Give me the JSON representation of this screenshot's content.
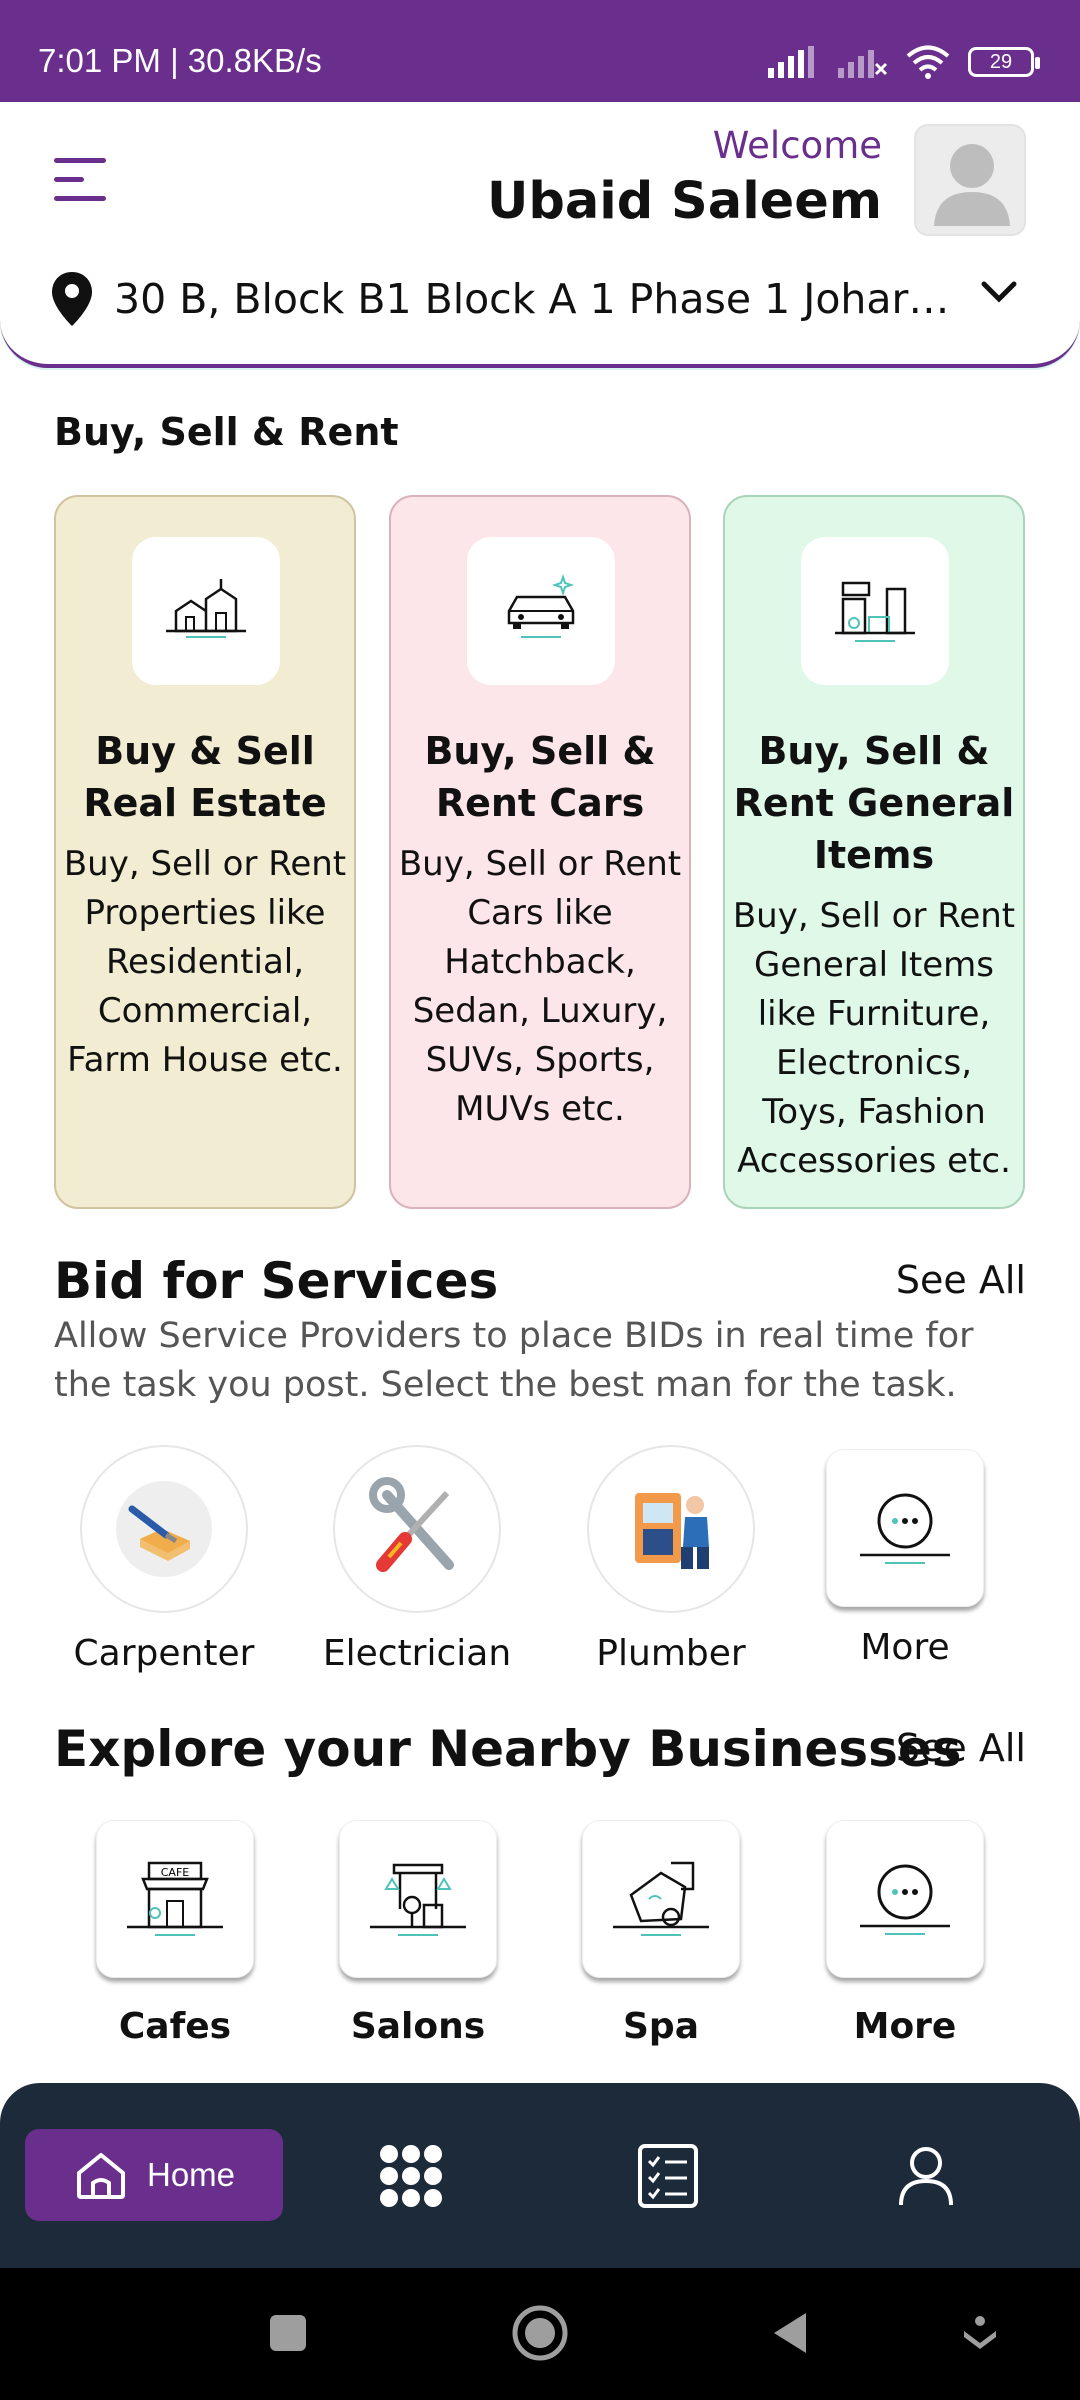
{
  "status_bar": {
    "time": "7:01 PM | 30.8KB/s",
    "battery": "29"
  },
  "header": {
    "welcome": "Welcome",
    "user_name": "Ubaid Saleem",
    "location": "30 B, Block B1 Block A 1 Phase 1 Johar T...",
    "accent_color": "#6a2f8c"
  },
  "buy_sell": {
    "title": "Buy, Sell & Rent",
    "cards": [
      {
        "title": "Buy & Sell Real Estate",
        "description": "Buy, Sell or Rent Properties like Residential, Commercial, Farm House etc.",
        "icon": "real-estate-icon",
        "bg": "#f2ecd2"
      },
      {
        "title": "Buy, Sell & Rent Cars",
        "description": "Buy, Sell or Rent Cars like Hatchback, Sedan, Luxury, SUVs, Sports, MUVs etc.",
        "icon": "car-icon",
        "bg": "#fde6ea"
      },
      {
        "title": "Buy, Sell & Rent General Items",
        "description": "Buy, Sell or Rent General Items like Furniture, Electronics, Toys, Fashion Accessories etc.",
        "icon": "general-items-icon",
        "bg": "#dff8e8"
      }
    ]
  },
  "services": {
    "title": "Bid for Services",
    "see_all": "See All",
    "description": "Allow Service Providers to place BIDs in real time for the task you post. Select the best man for the task.",
    "items": [
      {
        "label": "Carpenter",
        "icon": "carpenter-icon"
      },
      {
        "label": "Electrician",
        "icon": "electrician-icon"
      },
      {
        "label": "Plumber",
        "icon": "plumber-icon"
      },
      {
        "label": "More",
        "icon": "more-icon"
      }
    ]
  },
  "businesses": {
    "title": "Explore your Nearby Businesses",
    "see_all": "See All",
    "items": [
      {
        "label": "Cafes",
        "icon": "cafe-icon"
      },
      {
        "label": "Salons",
        "icon": "salon-icon"
      },
      {
        "label": "Spa",
        "icon": "spa-icon"
      },
      {
        "label": "More",
        "icon": "more-icon"
      }
    ]
  },
  "bottom_nav": {
    "home_label": "Home",
    "items": [
      "home-icon",
      "grid-icon",
      "checklist-icon",
      "profile-icon"
    ]
  }
}
